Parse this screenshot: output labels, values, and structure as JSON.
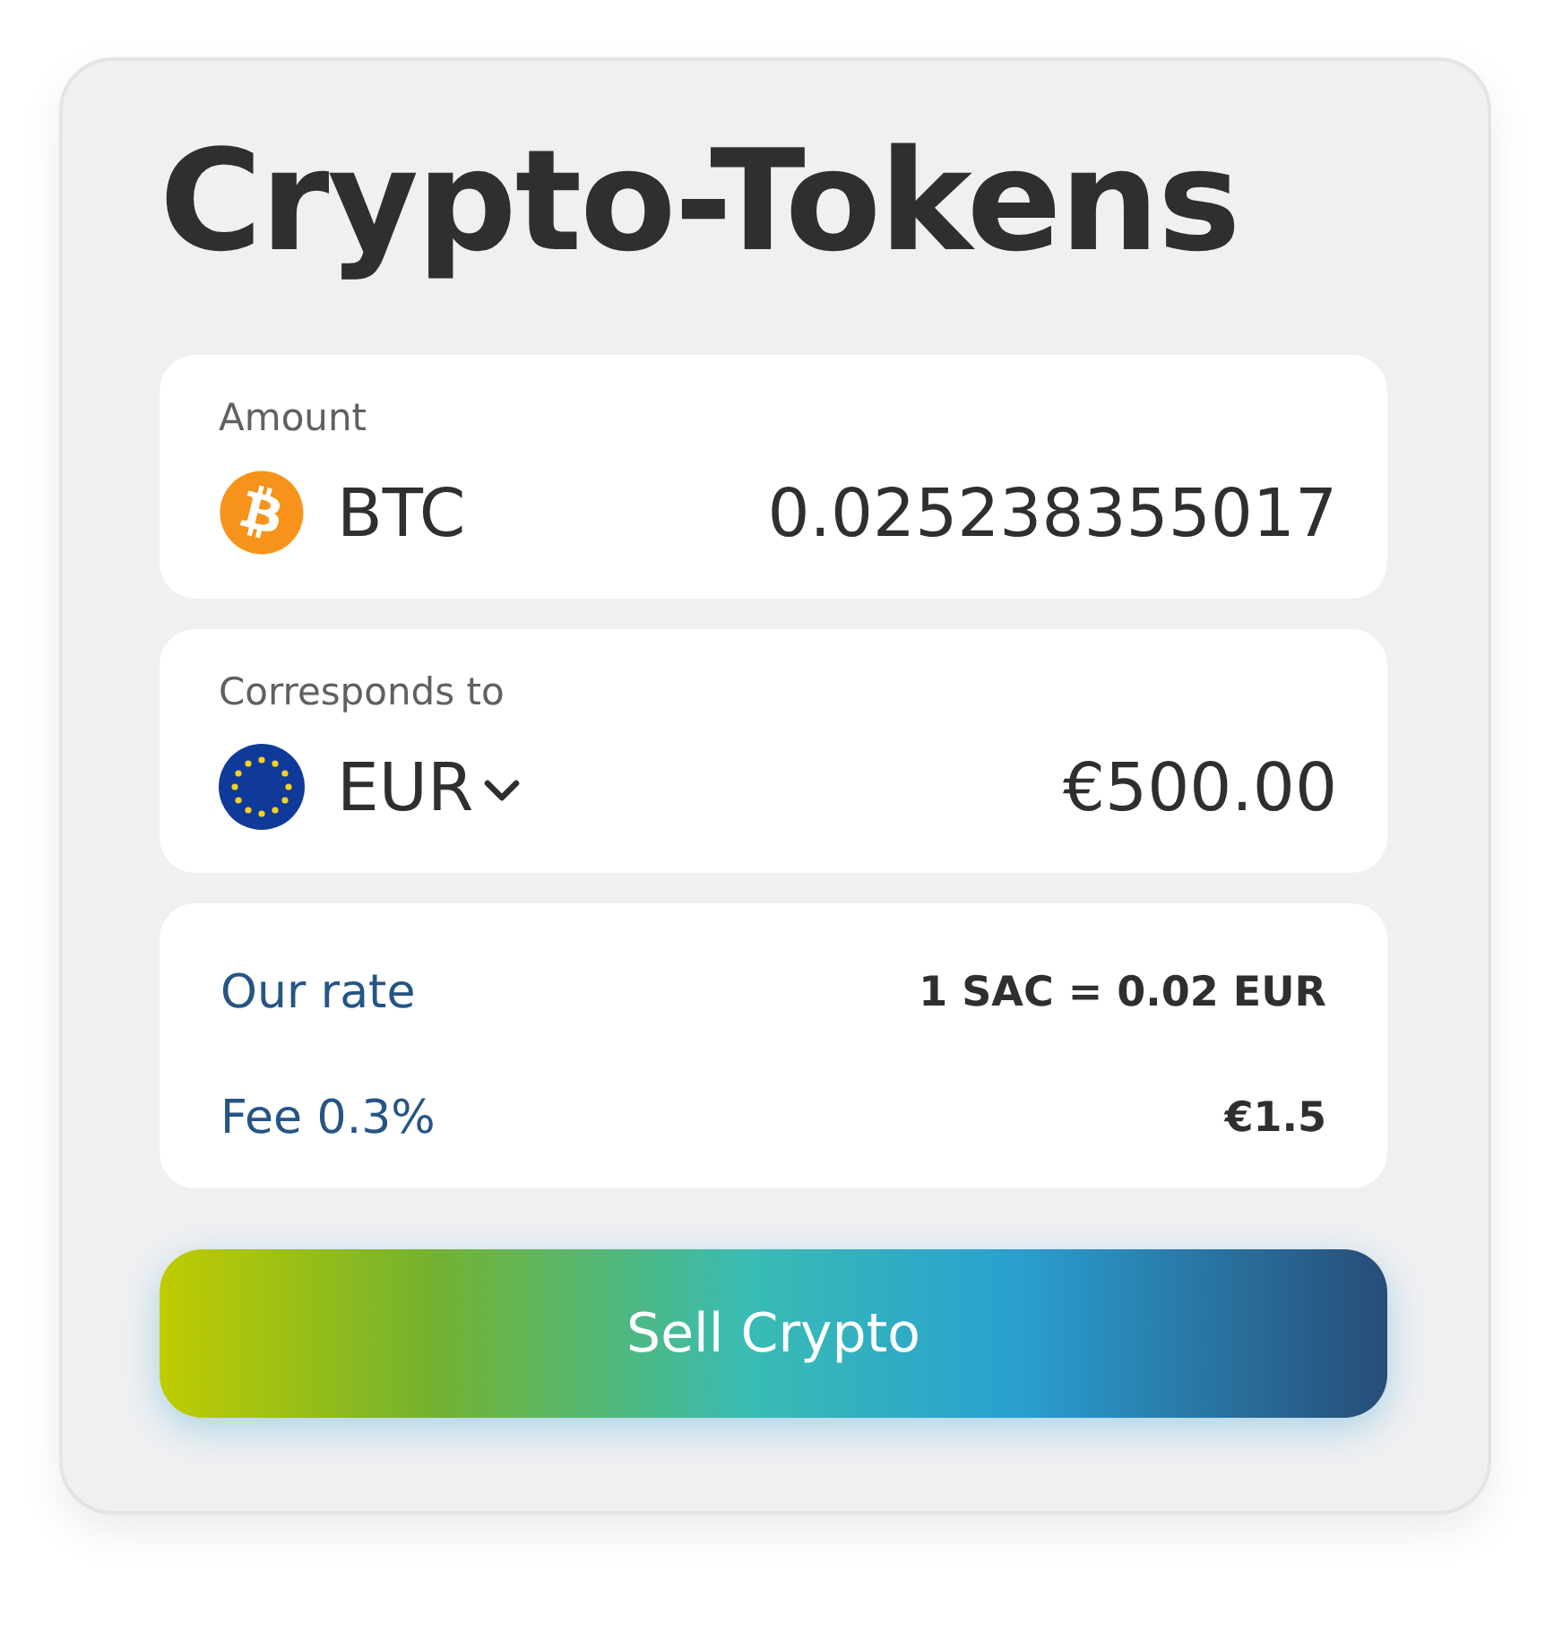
{
  "title": "Crypto-Tokens",
  "amount": {
    "label": "Amount",
    "currency": "BTC",
    "value": "0.025238355017"
  },
  "converted": {
    "label": "Corresponds to",
    "currency": "EUR",
    "value": "€500.00"
  },
  "details": [
    {
      "label": "Our rate",
      "value": "1 SAC = 0.02 EUR"
    },
    {
      "label": "Fee 0.3%",
      "value": "€1.5"
    }
  ],
  "button": "Sell Crypto"
}
